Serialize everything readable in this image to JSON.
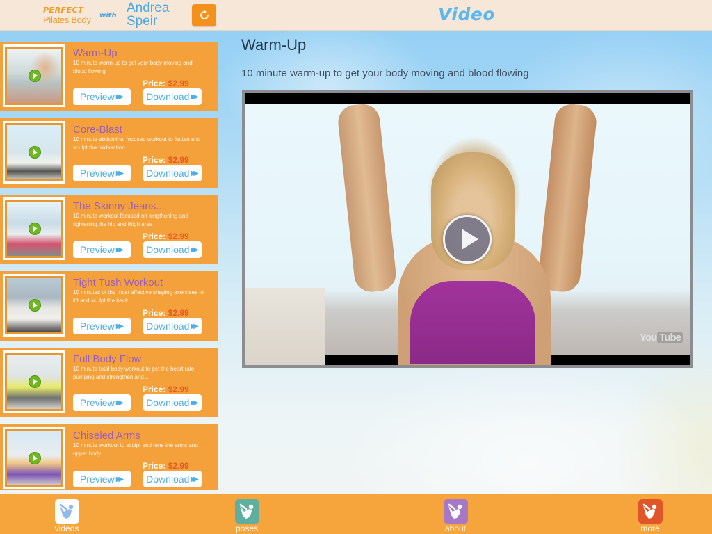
{
  "header": {
    "logo": {
      "line1": "PERFECT",
      "line2": "Pilates Body",
      "with": "with",
      "name1": "Andrea",
      "name2": "Speir"
    },
    "refresh_icon": "refresh-icon",
    "title": "Video"
  },
  "colors": {
    "accent_orange": "#f6a53c",
    "title_purple": "#9d5fb8",
    "price_red": "#e25a20",
    "link_blue": "#4eaee6",
    "header_bg": "#f6e7d9"
  },
  "videos": [
    {
      "title": "Warm-Up",
      "description": "10 minute warm-up to get your body moving and blood flowing",
      "price_label": "Price:",
      "price": "$2.99",
      "preview_label": "Preview",
      "download_label": "Download"
    },
    {
      "title": "Core-Blast",
      "description": "10 minute abdominal focused workout to flatten and sculpt the midsection...",
      "price_label": "Price:",
      "price": "$2.99",
      "preview_label": "Preview",
      "download_label": "Download"
    },
    {
      "title": "The Skinny Jeans...",
      "description": "10 minute workout focused on lengthening and tightening the hip and thigh area",
      "price_label": "Price:",
      "price": "$2.99",
      "preview_label": "Preview",
      "download_label": "Download"
    },
    {
      "title": "Tight Tush Workout",
      "description": "10 minutes of the most effective shaping exercises to lift and sculpt the back...",
      "price_label": "Price:",
      "price": "$2.99",
      "preview_label": "Preview",
      "download_label": "Download"
    },
    {
      "title": "Full Body Flow",
      "description": "10 minute total body workout to get the heart rate pumping and strengthen and...",
      "price_label": "Price:",
      "price": "$2.99",
      "preview_label": "Preview",
      "download_label": "Download"
    },
    {
      "title": "Chiseled Arms",
      "description": "10 minute workout to sculpt and tone the arms and upper body",
      "price_label": "Price:",
      "price": "$2.99",
      "preview_label": "Preview",
      "download_label": "Download"
    }
  ],
  "main": {
    "title": "Warm-Up",
    "description": "10 minute warm-up to get your body moving and blood flowing",
    "player": {
      "watermark_you": "You",
      "watermark_tube": "Tube"
    }
  },
  "tabbar": {
    "tabs": [
      {
        "label": "videos",
        "icon": "pilates-pose-icon",
        "color": "#ffffff",
        "glyph": "#8fb8ec",
        "selected": true
      },
      {
        "label": "poses",
        "icon": "pilates-pose-icon",
        "color": "#5fae9f",
        "glyph": "#ffffff",
        "selected": false
      },
      {
        "label": "about",
        "icon": "pilates-pose-icon",
        "color": "#a778c6",
        "glyph": "#ffffff",
        "selected": false
      },
      {
        "label": "more",
        "icon": "pilates-pose-icon",
        "color": "#e0562a",
        "glyph": "#ffffff",
        "selected": false
      }
    ]
  }
}
